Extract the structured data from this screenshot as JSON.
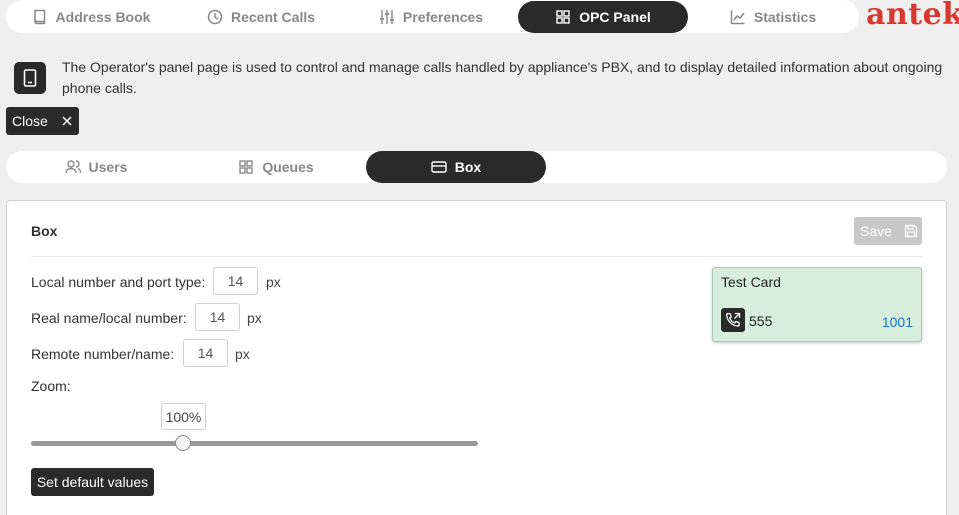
{
  "topnav": {
    "tabs": [
      {
        "label": "Address Book",
        "icon": "book-icon"
      },
      {
        "label": "Recent Calls",
        "icon": "clock-icon"
      },
      {
        "label": "Preferences",
        "icon": "sliders-icon"
      },
      {
        "label": "OPC Panel",
        "icon": "grid-icon",
        "active": true
      },
      {
        "label": "Statistics",
        "icon": "chart-icon"
      }
    ]
  },
  "brand": {
    "logo": "antek",
    "color": "#d8382f"
  },
  "info": {
    "text": "The Operator's panel page is used to control and manage calls handled by appliance's PBX, and to display detailed information about ongoing phone calls."
  },
  "close_label": "Close",
  "subnav": {
    "tabs": [
      {
        "label": "Users",
        "icon": "users-icon"
      },
      {
        "label": "Queues",
        "icon": "grid-icon"
      },
      {
        "label": "Box",
        "icon": "card-icon",
        "active": true
      }
    ]
  },
  "panel": {
    "title": "Box",
    "save_label": "Save",
    "fields": [
      {
        "label": "Local number and port type:",
        "value": "14",
        "unit": "px"
      },
      {
        "label": "Real name/local number:",
        "value": "14",
        "unit": "px"
      },
      {
        "label": "Remote number/name:",
        "value": "14",
        "unit": "px"
      }
    ],
    "zoom_label": "Zoom:",
    "zoom_value": "100%",
    "zoom_fraction": 0.34,
    "default_label": "Set default values"
  },
  "card": {
    "title": "Test Card",
    "remote": "555",
    "local": "1001",
    "background": "#d6eedb"
  }
}
